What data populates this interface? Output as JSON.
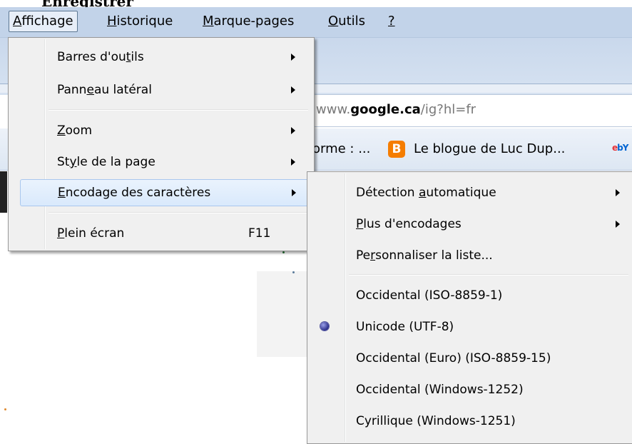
{
  "menubar": {
    "items": [
      {
        "label": "Affichage",
        "accel": "A",
        "rest": "ffichage"
      },
      {
        "label": "Historique",
        "accel": "H",
        "rest": "istorique"
      },
      {
        "label": "Marque-pages",
        "accel": "M",
        "rest": "arque-pages"
      },
      {
        "label": "Outils",
        "accel": "O",
        "rest": "utils"
      },
      {
        "label": "?",
        "accel": "?",
        "rest": ""
      }
    ]
  },
  "top_fragment": "Enregistrer",
  "address_bar": {
    "prefix": "www.",
    "domain": "google.ca",
    "path": "/ig?hl=fr"
  },
  "bookmarks": {
    "item1": "orme : ...",
    "blogger_icon_glyph": "B",
    "item2": "Le blogue de Luc Dup...",
    "ebay_e": "e",
    "ebay_b": "bY"
  },
  "view_menu": {
    "items": [
      {
        "pre": "Barres d'ou",
        "accel": "t",
        "post": "ils",
        "has_submenu": true
      },
      {
        "pre": "Pann",
        "accel": "e",
        "post": "au latéral",
        "has_submenu": true
      },
      {
        "pre": "",
        "accel": "Z",
        "post": "oom",
        "has_submenu": true
      },
      {
        "pre": "St",
        "accel": "y",
        "post": "le de la page",
        "has_submenu": true
      },
      {
        "pre": "",
        "accel": "E",
        "post": "ncodage des caractères",
        "has_submenu": true
      },
      {
        "pre": "",
        "accel": "P",
        "post": "lein écran",
        "shortcut": "F11"
      }
    ]
  },
  "encoding_submenu": {
    "items": [
      {
        "pre": "Détection ",
        "accel": "a",
        "post": "utomatique",
        "has_submenu": true
      },
      {
        "pre": "",
        "accel": "P",
        "post": "lus d'encodages",
        "has_submenu": true
      },
      {
        "pre": "Pe",
        "accel": "r",
        "post": "sonnaliser la liste..."
      },
      {
        "label": "Occidental (ISO-8859-1)"
      },
      {
        "label": "Unicode (UTF-8)",
        "selected": true
      },
      {
        "label": "Occidental (Euro) (ISO-8859-15)"
      },
      {
        "label": "Occidental (Windows-1252)"
      },
      {
        "label": "Cyrillique (Windows-1251)"
      }
    ]
  },
  "colors": {
    "menubar_bg": "#c2d3e9",
    "menu_bg": "#f0f0f0",
    "highlight_border": "#a9c7ee",
    "blogger_orange": "#f57d00"
  }
}
